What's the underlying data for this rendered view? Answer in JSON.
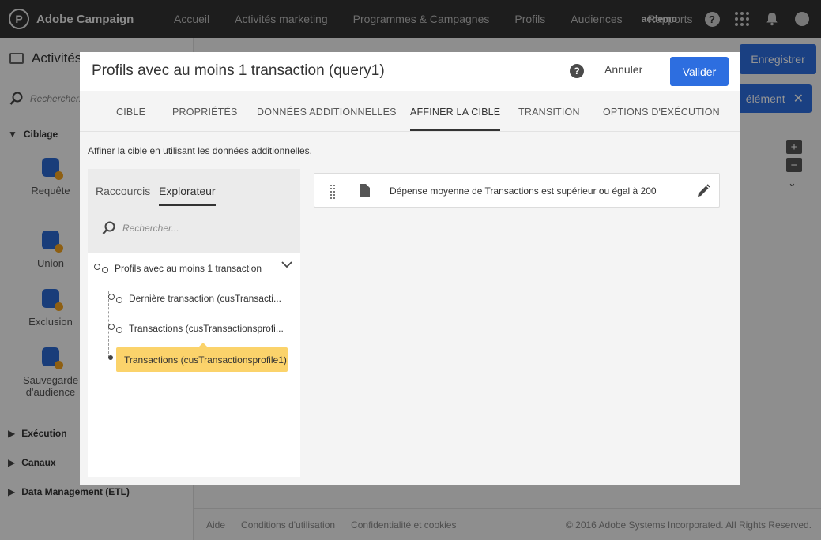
{
  "app": {
    "brand": "Adobe Campaign",
    "nav": [
      "Accueil",
      "Activités marketing",
      "Programmes & Campagnes",
      "Profils",
      "Audiences",
      "Rapports"
    ],
    "user": "acdemo"
  },
  "background": {
    "section_title": "Activités",
    "search_placeholder": "Rechercher...",
    "ciblage_label": "Ciblage",
    "activities": [
      "Requête",
      "Union",
      "Exclusion",
      "Sauvegarde d'audience"
    ],
    "sections": [
      "Exécution",
      "Canaux",
      "Data Management (ETL)"
    ],
    "save_label": "Enregistrer",
    "element_label": "élément",
    "footer": {
      "links": [
        "Aide",
        "Conditions d'utilisation",
        "Confidentialité et cookies"
      ],
      "copyright": "© 2016 Adobe Systems Incorporated. All Rights Reserved."
    }
  },
  "modal": {
    "title": "Profils avec au moins 1 transaction (query1)",
    "cancel_label": "Annuler",
    "validate_label": "Valider",
    "tabs": [
      "CIBLE",
      "PROPRIÉTÉS",
      "DONNÉES ADDITIONNELLES",
      "AFFINER LA CIBLE",
      "TRANSITION",
      "OPTIONS D'EXÉCUTION"
    ],
    "active_tab": "AFFINER LA CIBLE",
    "intro": "Affiner la cible en utilisant les données additionnelles.",
    "panel_tabs": [
      "Raccourcis",
      "Explorateur"
    ],
    "panel_active_tab": "Explorateur",
    "panel_search_placeholder": "Rechercher...",
    "tree": {
      "root": "Profils avec au moins 1 transaction",
      "children": [
        "Dernière transaction (cusTransacti...",
        "Transactions (cusTransactionsprofi..."
      ]
    },
    "tooltip": "Transactions (cusTransactionsprofile1)",
    "condition": "Dépense moyenne de Transactions est supérieur ou égal à 200"
  }
}
